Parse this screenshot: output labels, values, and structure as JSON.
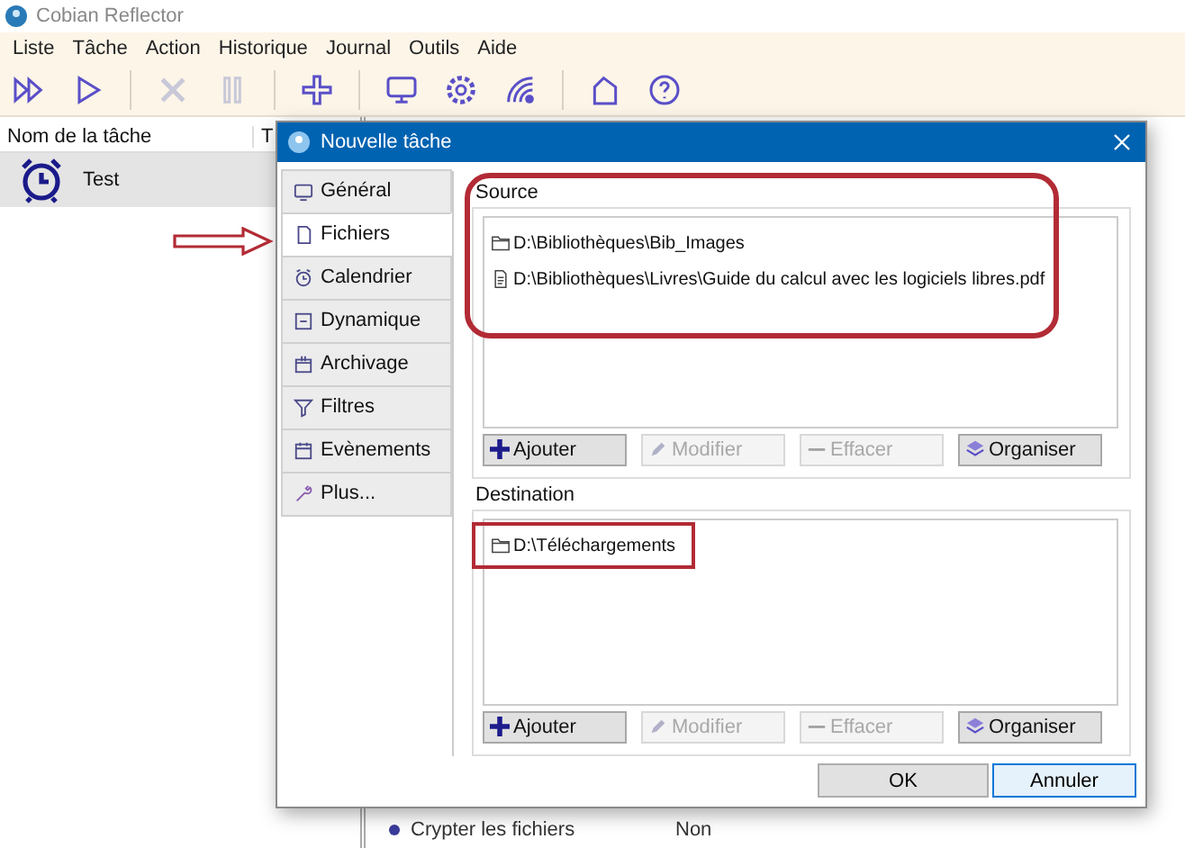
{
  "app": {
    "title": "Cobian Reflector"
  },
  "menu": [
    "Liste",
    "Tâche",
    "Action",
    "Historique",
    "Journal",
    "Outils",
    "Aide"
  ],
  "toolbar": [
    {
      "kind": "run-all",
      "disabled": false
    },
    {
      "kind": "run",
      "disabled": false
    },
    {
      "kind": "stop",
      "disabled": true
    },
    {
      "kind": "pause",
      "disabled": true
    },
    {
      "kind": "add",
      "disabled": false
    },
    {
      "kind": "monitor",
      "disabled": false
    },
    {
      "kind": "settings",
      "disabled": false
    },
    {
      "kind": "signal",
      "disabled": false
    },
    {
      "kind": "home",
      "disabled": false
    },
    {
      "kind": "help",
      "disabled": false
    }
  ],
  "task_list": {
    "columns": [
      "Nom de la tâche",
      "T"
    ],
    "rows": [
      {
        "name": "Test",
        "selected": true
      }
    ]
  },
  "properties": [
    {
      "name": "Crypter les fichiers",
      "value": "Non"
    }
  ],
  "dialog": {
    "title": "Nouvelle tâche",
    "tabs": [
      {
        "label": "Général",
        "kind": "monitor",
        "selected": false
      },
      {
        "label": "Fichiers",
        "kind": "file",
        "selected": true
      },
      {
        "label": "Calendrier",
        "kind": "clock",
        "selected": false
      },
      {
        "label": "Dynamique",
        "kind": "box",
        "selected": false
      },
      {
        "label": "Archivage",
        "kind": "archive",
        "selected": false
      },
      {
        "label": "Filtres",
        "kind": "filter",
        "selected": false
      },
      {
        "label": "Evènements",
        "kind": "calendar",
        "selected": false
      },
      {
        "label": "Plus...",
        "kind": "wrench",
        "selected": false
      }
    ],
    "source": {
      "label": "Source",
      "items": [
        {
          "kind": "folder",
          "path": "D:\\Bibliothèques\\Bib_Images"
        },
        {
          "kind": "file",
          "path": "D:\\Bibliothèques\\Livres\\Guide du calcul avec les logiciels libres.pdf"
        }
      ],
      "buttons": [
        {
          "label": "Ajouter",
          "kind": "add",
          "disabled": false
        },
        {
          "label": "Modifier",
          "kind": "edit",
          "disabled": true
        },
        {
          "label": "Effacer",
          "kind": "delete",
          "disabled": true
        },
        {
          "label": "Organiser",
          "kind": "organize",
          "disabled": false
        }
      ]
    },
    "destination": {
      "label": "Destination",
      "items": [
        {
          "kind": "folder",
          "path": "D:\\Téléchargements"
        }
      ],
      "buttons": [
        {
          "label": "Ajouter",
          "kind": "add",
          "disabled": false
        },
        {
          "label": "Modifier",
          "kind": "edit",
          "disabled": true
        },
        {
          "label": "Effacer",
          "kind": "delete",
          "disabled": true
        },
        {
          "label": "Organiser",
          "kind": "organize",
          "disabled": false
        }
      ]
    },
    "footer": [
      {
        "label": "OK",
        "focused": false
      },
      {
        "label": "Annuler",
        "focused": true
      }
    ]
  }
}
